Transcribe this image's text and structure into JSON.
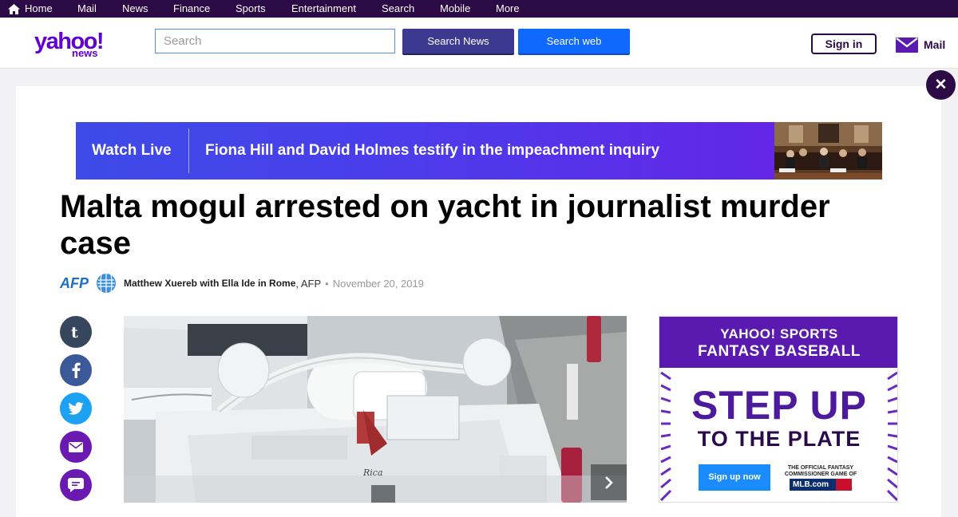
{
  "topnav": {
    "items": [
      "Home",
      "Mail",
      "News",
      "Finance",
      "Sports",
      "Entertainment",
      "Search",
      "Mobile",
      "More"
    ]
  },
  "header": {
    "logo_line1": "yahoo!",
    "logo_line2": "news",
    "search_placeholder": "Search",
    "search_news_label": "Search News",
    "search_web_label": "Search web",
    "signin_label": "Sign in",
    "mail_label": "Mail"
  },
  "banner": {
    "watch_label": "Watch Live",
    "headline": "Fiona Hill and David Holmes testify in the impeachment inquiry"
  },
  "article": {
    "title": "Malta mogul arrested on yacht in journalist murder case",
    "source_logo": "AFP",
    "author": "Matthew Xuereb with Ella Ide in Rome",
    "source": ", AFP",
    "date": "November 20, 2019"
  },
  "hero": {
    "boat_name": "Rica"
  },
  "ad": {
    "brand": "YAHOO! SPORTS",
    "product": "FANTASY BASEBALL",
    "headline1": "STEP UP",
    "headline2": "TO THE PLATE",
    "cta": "Sign up now",
    "fine_print": "THE OFFICIAL FANTASY COMMISSIONER GAME OF",
    "partner": "MLB.com"
  },
  "colors": {
    "nav_bg": "#2b0a46",
    "brand_purple": "#6001d2",
    "search_news_bg": "#3b3990",
    "search_web_bg": "#0f69ff"
  },
  "icons": {
    "home": "home-icon",
    "mail": "mail-icon",
    "close": "close-icon",
    "tumblr": "tumblr-icon",
    "facebook": "facebook-icon",
    "twitter": "twitter-icon",
    "email": "email-icon",
    "comments": "comments-icon",
    "next": "chevron-right-icon"
  }
}
